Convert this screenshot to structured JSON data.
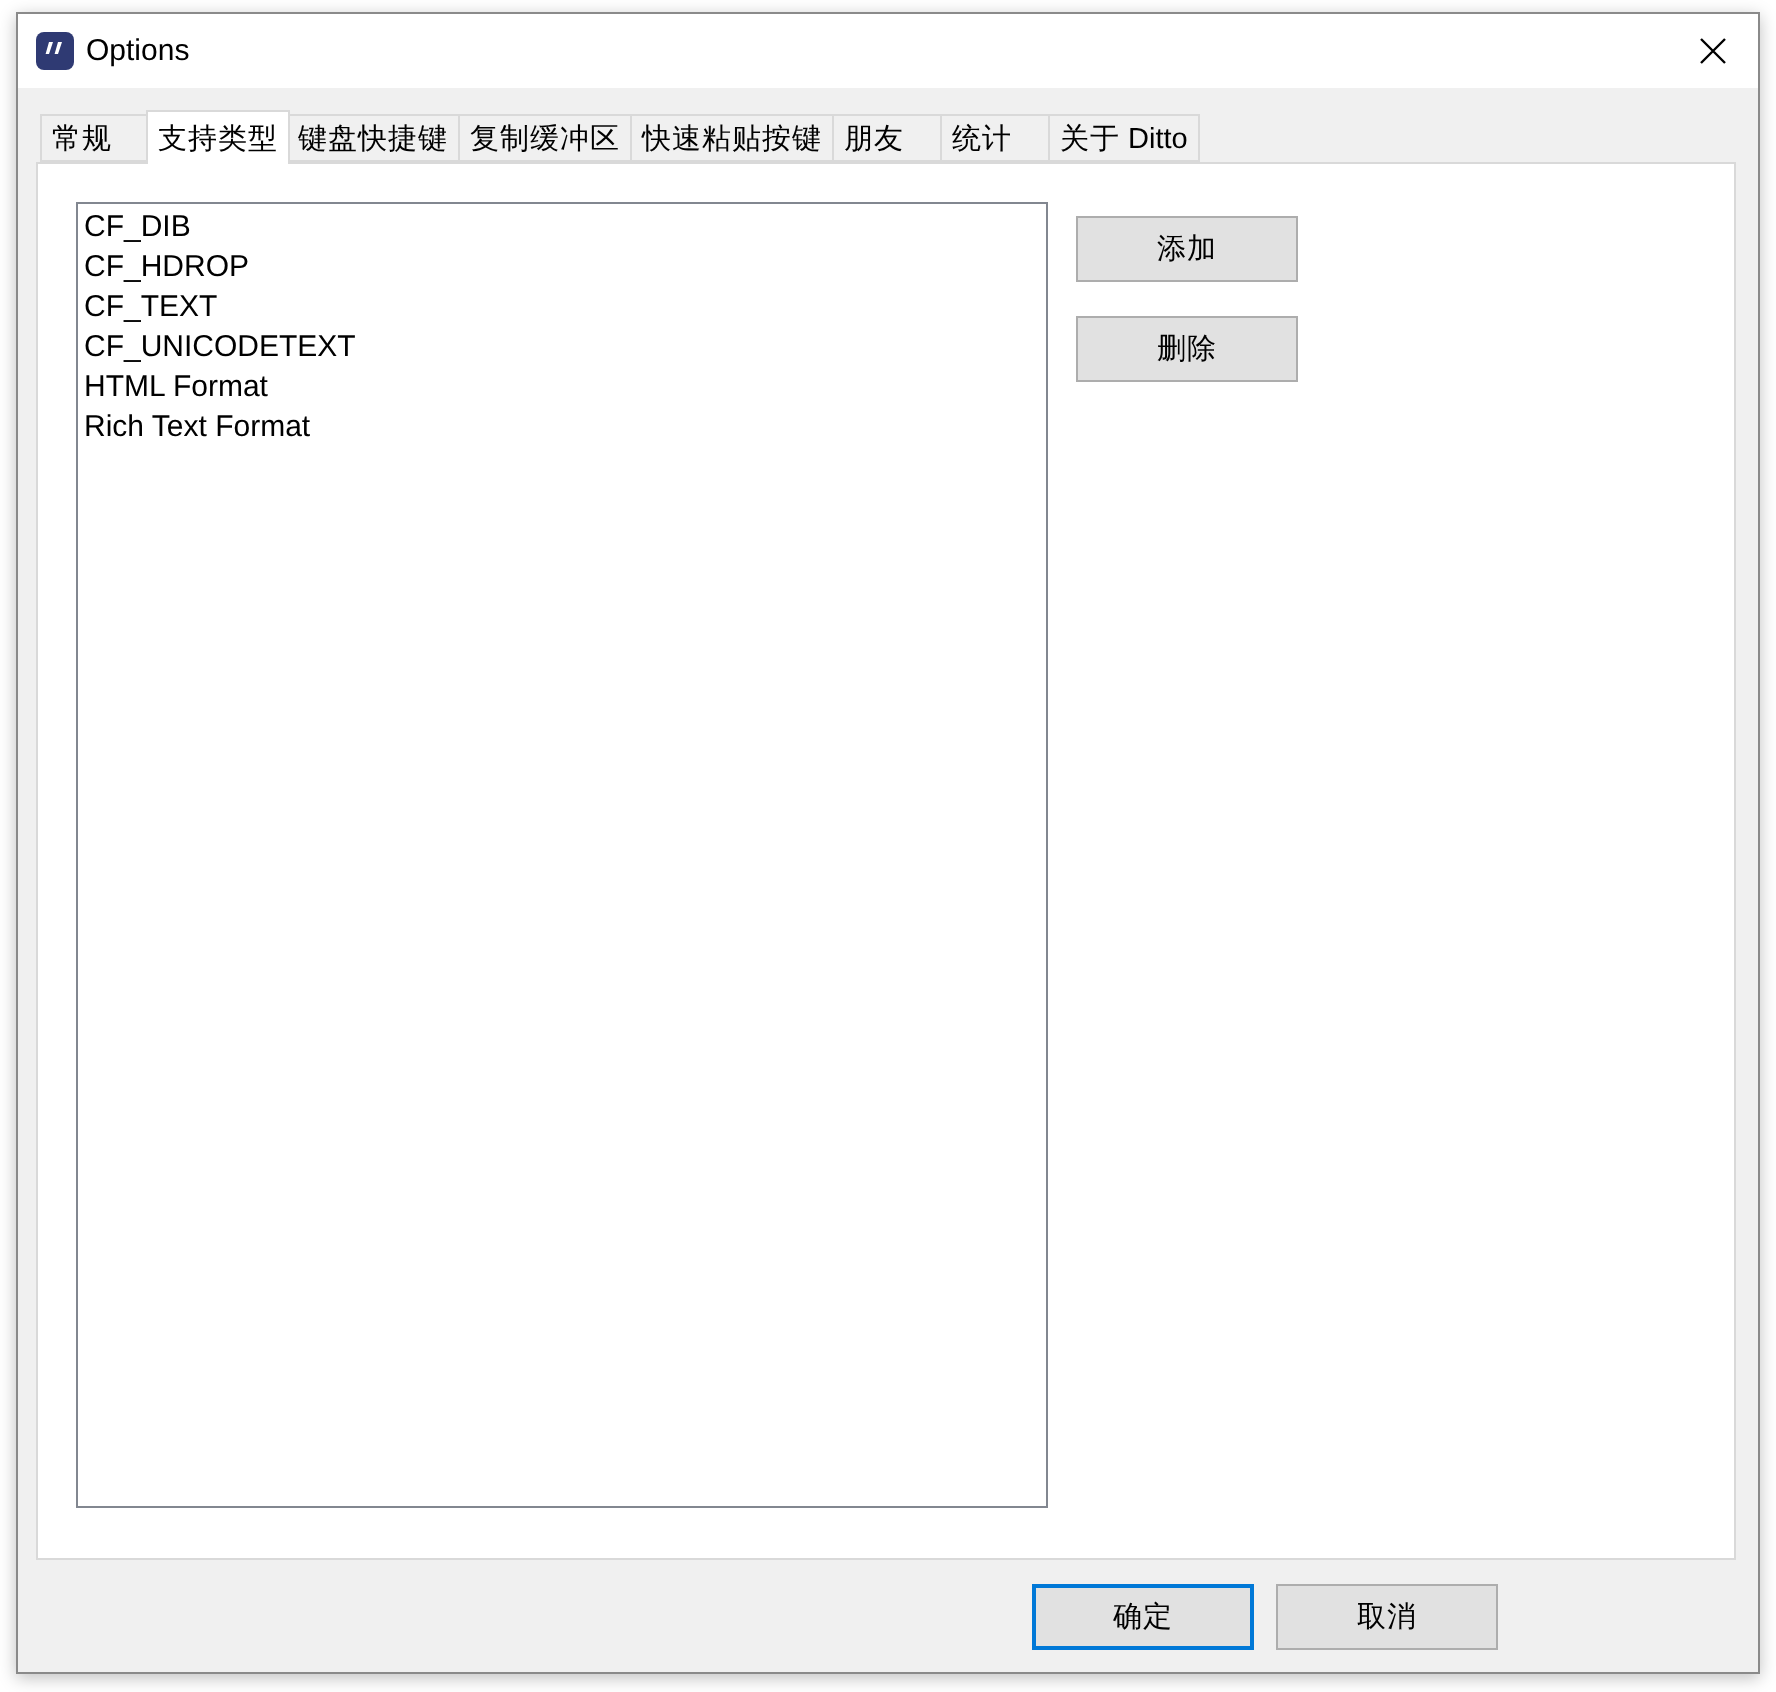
{
  "window": {
    "title": "Options"
  },
  "tabs": [
    {
      "label": "常规",
      "selected": false
    },
    {
      "label": "支持类型",
      "selected": true
    },
    {
      "label": "键盘快捷键",
      "selected": false
    },
    {
      "label": "复制缓冲区",
      "selected": false
    },
    {
      "label": "快速粘贴按键",
      "selected": false
    },
    {
      "label": "朋友",
      "selected": false
    },
    {
      "label": "统计",
      "selected": false
    },
    {
      "label": "关于 Ditto",
      "selected": false
    }
  ],
  "formats": {
    "items": [
      "CF_DIB",
      "CF_HDROP",
      "CF_TEXT",
      "CF_UNICODETEXT",
      "HTML Format",
      "Rich Text Format"
    ]
  },
  "side_buttons": [
    "添加",
    "删除"
  ],
  "footer_buttons": [
    {
      "label": "确定",
      "focused": true
    },
    {
      "label": "取消",
      "focused": false
    }
  ]
}
